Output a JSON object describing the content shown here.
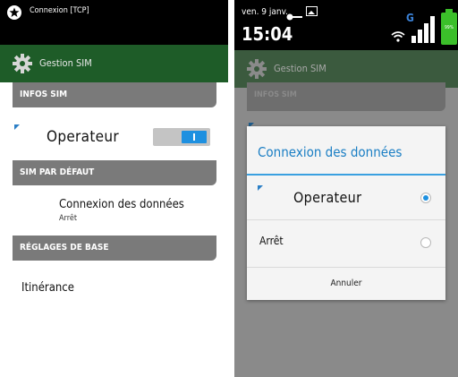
{
  "left_screen": {
    "status_bar": {
      "notification_text": "Connexion [TCP]",
      "notification_icon": "app-star-icon"
    },
    "header": {
      "title": "Gestion SIM",
      "icon": "gear-icon"
    },
    "sections": {
      "infos_sim": "INFOS SIM",
      "sim_par_defaut": "SIM PAR DÉFAUT",
      "reglages_de_base": "RÉGLAGES DE BASE"
    },
    "operator": {
      "label": "Operateur",
      "toggle_on": true
    },
    "data_connection": {
      "title": "Connexion des données",
      "value": "Arrêt"
    },
    "roaming": {
      "label": "Itinérance"
    }
  },
  "right_screen": {
    "status_bar": {
      "date": "ven. 9 janv.",
      "time": "15:04",
      "network": "G",
      "battery_text": "99%"
    },
    "header": {
      "title": "Gestion SIM"
    },
    "sections": {
      "infos_sim": "INFOS SIM"
    },
    "dialog": {
      "title": "Connexion des données",
      "options": [
        {
          "label": "Operateur",
          "selected": true
        },
        {
          "label": "Arrêt",
          "selected": false
        }
      ],
      "cancel_label": "Annuler"
    }
  },
  "colors": {
    "header_green": "#1e5c28",
    "accent_blue": "#1e90e0",
    "section_gray": "#7a7a7a",
    "battery_green": "#3bbf2a"
  }
}
